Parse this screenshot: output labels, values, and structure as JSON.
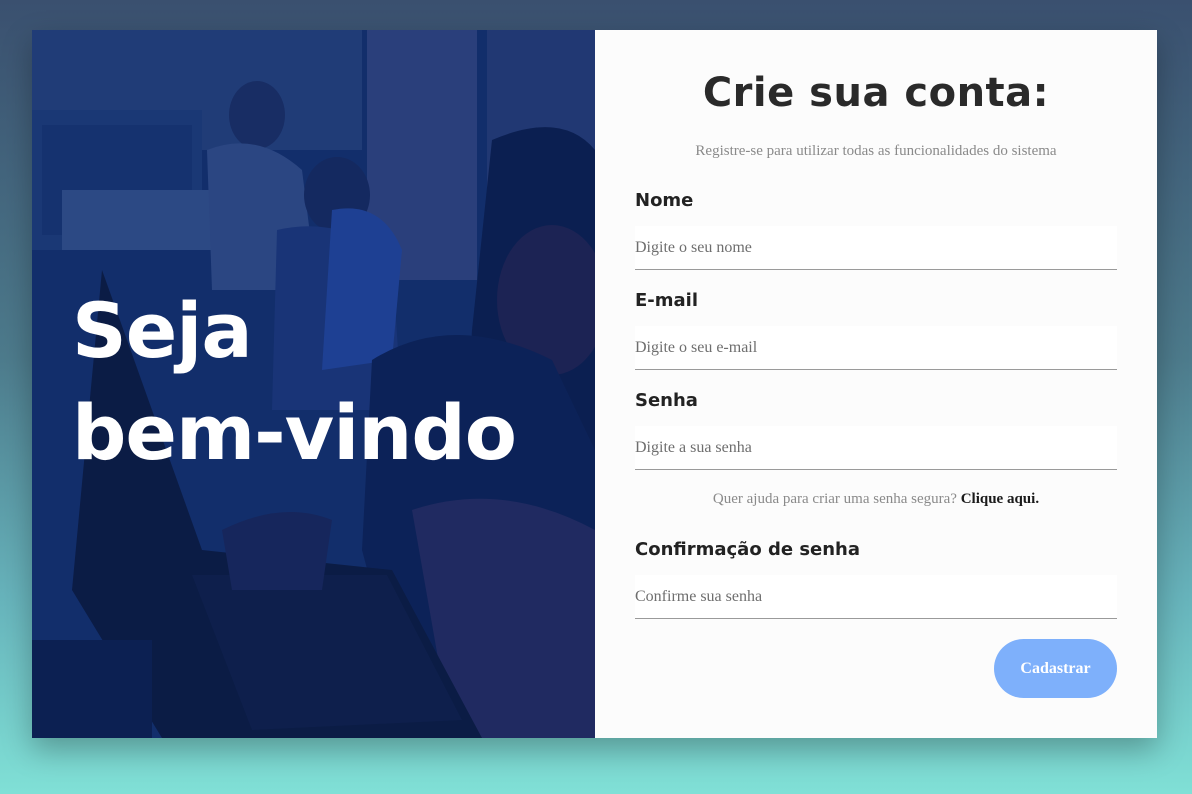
{
  "welcome": {
    "line1": "Seja",
    "line2": "bem-vindo"
  },
  "form": {
    "title": "Crie sua conta:",
    "subtitle": "Registre-se para utilizar todas as funcionalidades do sistema",
    "fields": [
      {
        "label": "Nome",
        "placeholder": "Digite o seu nome",
        "value": ""
      },
      {
        "label": "E-mail",
        "placeholder": "Digite o seu e-mail",
        "value": ""
      },
      {
        "label": "Senha",
        "placeholder": "Digite a sua senha",
        "value": ""
      },
      {
        "label": "Confirmação de senha",
        "placeholder": "Confirme sua senha",
        "value": ""
      }
    ],
    "help_text": "Quer ajuda para criar uma senha segura?",
    "help_link": "Clique aqui.",
    "submit_label": "Cadastrar"
  },
  "colors": {
    "panel_overlay": "#0f2a66",
    "button": "#7eb0fb",
    "background_top": "#3a506f",
    "background_bottom": "#80e0d6"
  }
}
